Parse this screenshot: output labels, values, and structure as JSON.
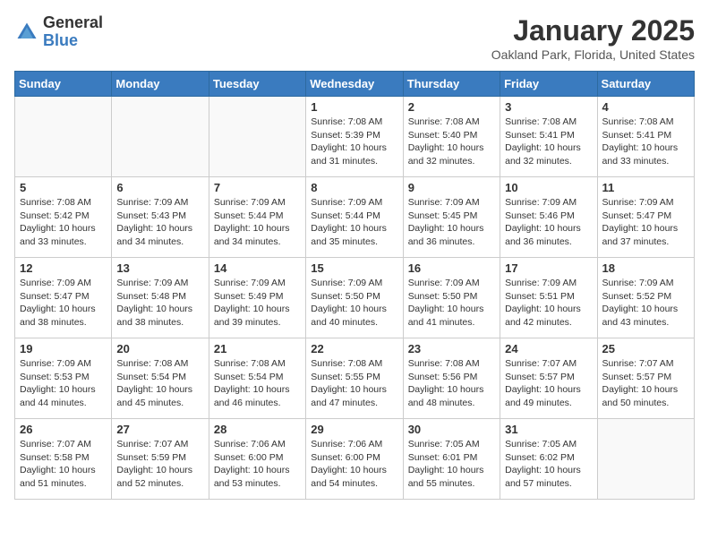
{
  "header": {
    "logo_general": "General",
    "logo_blue": "Blue",
    "title": "January 2025",
    "subtitle": "Oakland Park, Florida, United States"
  },
  "days_of_week": [
    "Sunday",
    "Monday",
    "Tuesday",
    "Wednesday",
    "Thursday",
    "Friday",
    "Saturday"
  ],
  "weeks": [
    [
      {
        "day": null,
        "info": null
      },
      {
        "day": null,
        "info": null
      },
      {
        "day": null,
        "info": null
      },
      {
        "day": "1",
        "info": "Sunrise: 7:08 AM\nSunset: 5:39 PM\nDaylight: 10 hours\nand 31 minutes."
      },
      {
        "day": "2",
        "info": "Sunrise: 7:08 AM\nSunset: 5:40 PM\nDaylight: 10 hours\nand 32 minutes."
      },
      {
        "day": "3",
        "info": "Sunrise: 7:08 AM\nSunset: 5:41 PM\nDaylight: 10 hours\nand 32 minutes."
      },
      {
        "day": "4",
        "info": "Sunrise: 7:08 AM\nSunset: 5:41 PM\nDaylight: 10 hours\nand 33 minutes."
      }
    ],
    [
      {
        "day": "5",
        "info": "Sunrise: 7:08 AM\nSunset: 5:42 PM\nDaylight: 10 hours\nand 33 minutes."
      },
      {
        "day": "6",
        "info": "Sunrise: 7:09 AM\nSunset: 5:43 PM\nDaylight: 10 hours\nand 34 minutes."
      },
      {
        "day": "7",
        "info": "Sunrise: 7:09 AM\nSunset: 5:44 PM\nDaylight: 10 hours\nand 34 minutes."
      },
      {
        "day": "8",
        "info": "Sunrise: 7:09 AM\nSunset: 5:44 PM\nDaylight: 10 hours\nand 35 minutes."
      },
      {
        "day": "9",
        "info": "Sunrise: 7:09 AM\nSunset: 5:45 PM\nDaylight: 10 hours\nand 36 minutes."
      },
      {
        "day": "10",
        "info": "Sunrise: 7:09 AM\nSunset: 5:46 PM\nDaylight: 10 hours\nand 36 minutes."
      },
      {
        "day": "11",
        "info": "Sunrise: 7:09 AM\nSunset: 5:47 PM\nDaylight: 10 hours\nand 37 minutes."
      }
    ],
    [
      {
        "day": "12",
        "info": "Sunrise: 7:09 AM\nSunset: 5:47 PM\nDaylight: 10 hours\nand 38 minutes."
      },
      {
        "day": "13",
        "info": "Sunrise: 7:09 AM\nSunset: 5:48 PM\nDaylight: 10 hours\nand 38 minutes."
      },
      {
        "day": "14",
        "info": "Sunrise: 7:09 AM\nSunset: 5:49 PM\nDaylight: 10 hours\nand 39 minutes."
      },
      {
        "day": "15",
        "info": "Sunrise: 7:09 AM\nSunset: 5:50 PM\nDaylight: 10 hours\nand 40 minutes."
      },
      {
        "day": "16",
        "info": "Sunrise: 7:09 AM\nSunset: 5:50 PM\nDaylight: 10 hours\nand 41 minutes."
      },
      {
        "day": "17",
        "info": "Sunrise: 7:09 AM\nSunset: 5:51 PM\nDaylight: 10 hours\nand 42 minutes."
      },
      {
        "day": "18",
        "info": "Sunrise: 7:09 AM\nSunset: 5:52 PM\nDaylight: 10 hours\nand 43 minutes."
      }
    ],
    [
      {
        "day": "19",
        "info": "Sunrise: 7:09 AM\nSunset: 5:53 PM\nDaylight: 10 hours\nand 44 minutes."
      },
      {
        "day": "20",
        "info": "Sunrise: 7:08 AM\nSunset: 5:54 PM\nDaylight: 10 hours\nand 45 minutes."
      },
      {
        "day": "21",
        "info": "Sunrise: 7:08 AM\nSunset: 5:54 PM\nDaylight: 10 hours\nand 46 minutes."
      },
      {
        "day": "22",
        "info": "Sunrise: 7:08 AM\nSunset: 5:55 PM\nDaylight: 10 hours\nand 47 minutes."
      },
      {
        "day": "23",
        "info": "Sunrise: 7:08 AM\nSunset: 5:56 PM\nDaylight: 10 hours\nand 48 minutes."
      },
      {
        "day": "24",
        "info": "Sunrise: 7:07 AM\nSunset: 5:57 PM\nDaylight: 10 hours\nand 49 minutes."
      },
      {
        "day": "25",
        "info": "Sunrise: 7:07 AM\nSunset: 5:57 PM\nDaylight: 10 hours\nand 50 minutes."
      }
    ],
    [
      {
        "day": "26",
        "info": "Sunrise: 7:07 AM\nSunset: 5:58 PM\nDaylight: 10 hours\nand 51 minutes."
      },
      {
        "day": "27",
        "info": "Sunrise: 7:07 AM\nSunset: 5:59 PM\nDaylight: 10 hours\nand 52 minutes."
      },
      {
        "day": "28",
        "info": "Sunrise: 7:06 AM\nSunset: 6:00 PM\nDaylight: 10 hours\nand 53 minutes."
      },
      {
        "day": "29",
        "info": "Sunrise: 7:06 AM\nSunset: 6:00 PM\nDaylight: 10 hours\nand 54 minutes."
      },
      {
        "day": "30",
        "info": "Sunrise: 7:05 AM\nSunset: 6:01 PM\nDaylight: 10 hours\nand 55 minutes."
      },
      {
        "day": "31",
        "info": "Sunrise: 7:05 AM\nSunset: 6:02 PM\nDaylight: 10 hours\nand 57 minutes."
      },
      {
        "day": null,
        "info": null
      }
    ]
  ]
}
